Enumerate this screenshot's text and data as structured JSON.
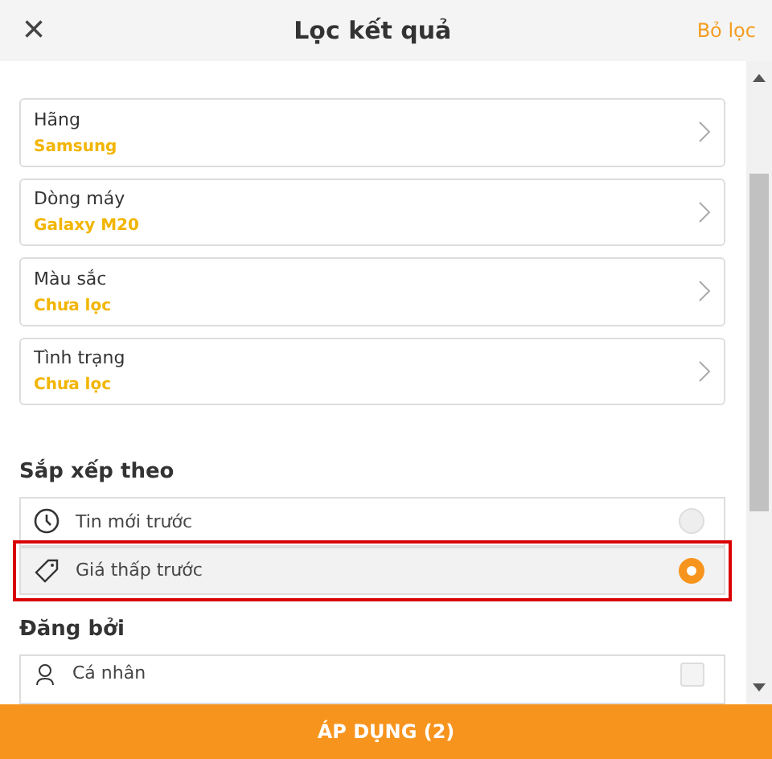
{
  "header": {
    "close": "×",
    "title": "Lọc kết quả",
    "reset": "Bỏ lọc"
  },
  "filters": [
    {
      "label": "Hãng",
      "value": "Samsung"
    },
    {
      "label": "Dòng máy",
      "value": "Galaxy M20"
    },
    {
      "label": "Màu sắc",
      "value": "Chưa lọc"
    },
    {
      "label": "Tình trạng",
      "value": "Chưa lọc"
    }
  ],
  "sort": {
    "heading": "Sắp xếp theo",
    "options": [
      {
        "kind": "clock",
        "label": "Tin mới trước",
        "selected": false,
        "highlighted": false
      },
      {
        "kind": "tag",
        "label": "Giá thấp trước",
        "selected": true,
        "highlighted": true
      }
    ]
  },
  "posted_by": {
    "heading": "Đăng bởi",
    "options": [
      {
        "kind": "person",
        "label": "Cá nhân",
        "checked": false
      }
    ]
  },
  "apply_button": "ÁP DỤNG (2)"
}
